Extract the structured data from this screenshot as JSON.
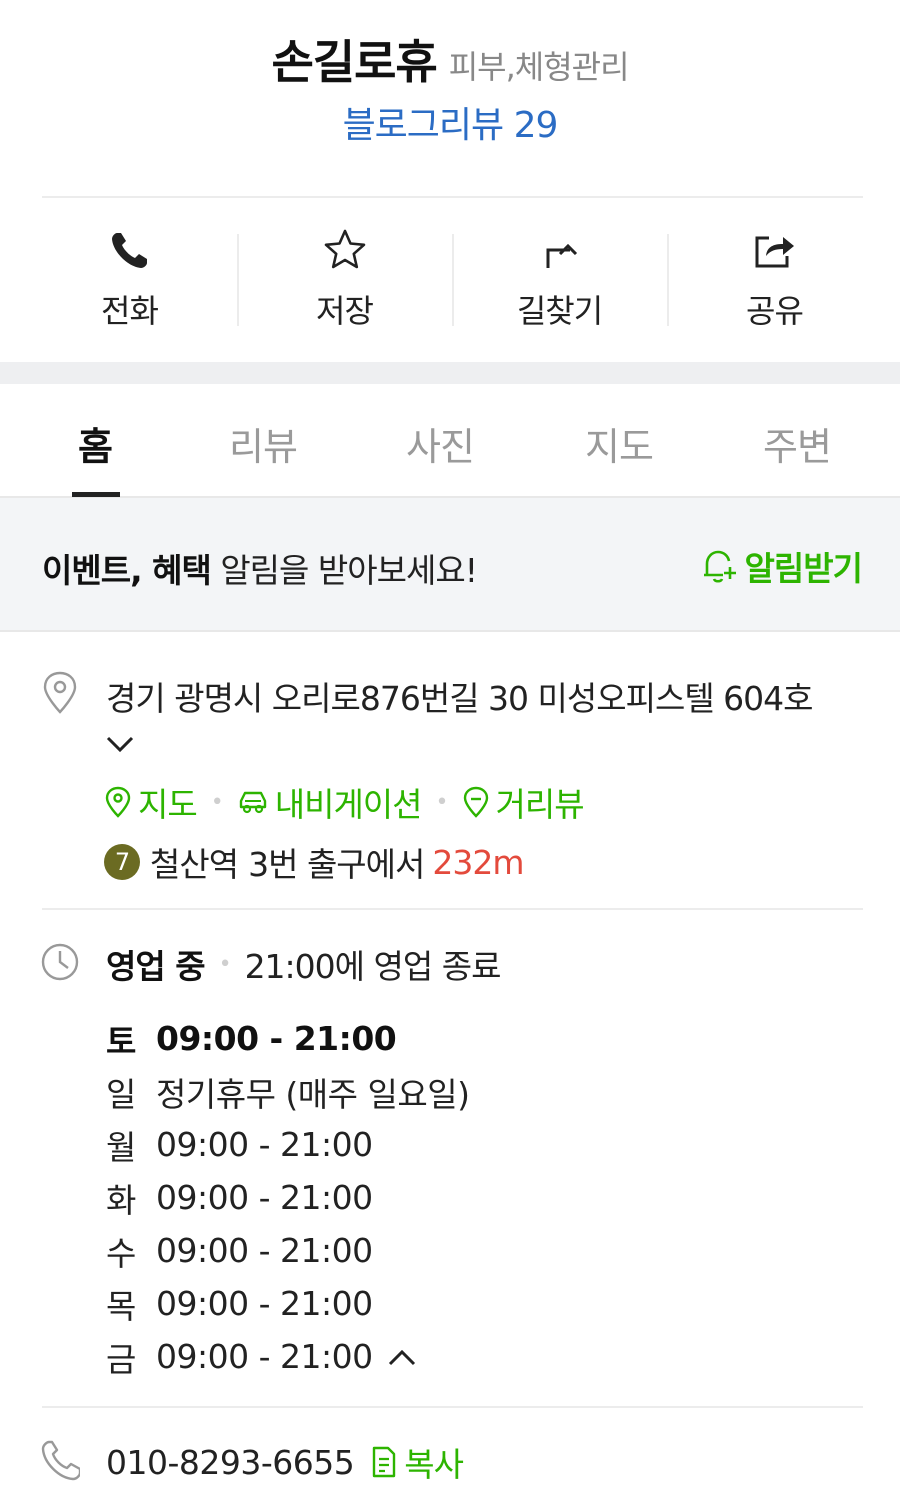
{
  "header": {
    "title": "손길로휴",
    "category": "피부,체형관리",
    "blog_review": "블로그리뷰 29"
  },
  "actions": [
    {
      "label": "전화",
      "icon": "phone-icon"
    },
    {
      "label": "저장",
      "icon": "star-icon"
    },
    {
      "label": "길찾기",
      "icon": "directions-icon"
    },
    {
      "label": "공유",
      "icon": "share-icon"
    }
  ],
  "tabs": [
    "홈",
    "리뷰",
    "사진",
    "지도",
    "주변"
  ],
  "notice": {
    "bold_text": "이벤트, 혜택",
    "text": " 알림을 받아보세요!",
    "button": "알림받기",
    "accent": "#2db400"
  },
  "address": {
    "text": "경기 광명시 오리로876번길 30 미성오피스텔 604호",
    "links": [
      "지도",
      "내비게이션",
      "거리뷰"
    ],
    "subway_line": "7",
    "station": "철산역",
    "exit": "3번 출구에서",
    "distance": "232m"
  },
  "hours": {
    "status": "영업 중",
    "closing": "21:00에 영업 종료",
    "rows": [
      {
        "day": "토",
        "time": "09:00 - 21:00"
      },
      {
        "day": "일",
        "time": "정기휴무 (매주 일요일)"
      },
      {
        "day": "월",
        "time": "09:00 - 21:00"
      },
      {
        "day": "화",
        "time": "09:00 - 21:00"
      },
      {
        "day": "수",
        "time": "09:00 - 21:00"
      },
      {
        "day": "목",
        "time": "09:00 - 21:00"
      },
      {
        "day": "금",
        "time": "09:00 - 21:00"
      }
    ]
  },
  "phone": {
    "number": "010-8293-6655",
    "copy_label": "복사"
  },
  "colors": {
    "link_blue": "#2b6cc4",
    "green": "#2db400",
    "distance_red": "#e34a3c",
    "line7": "#6b6b22"
  }
}
